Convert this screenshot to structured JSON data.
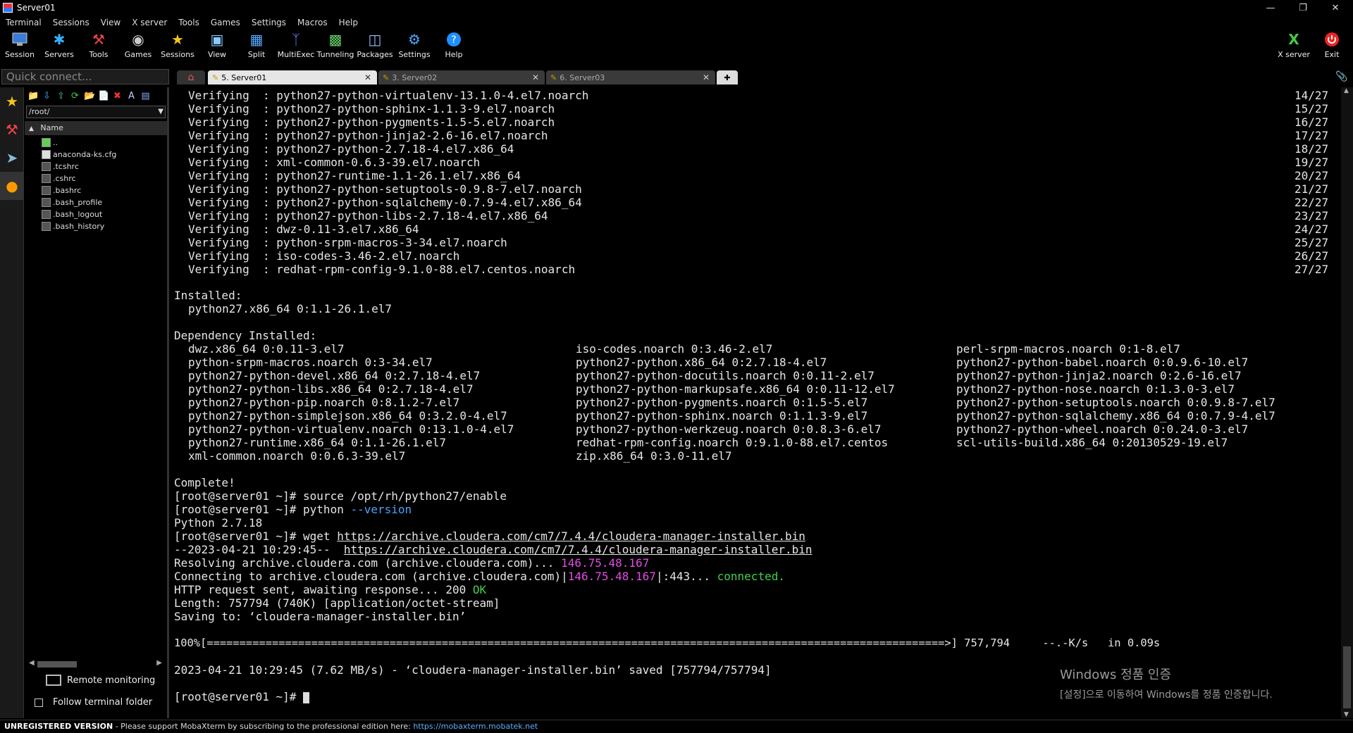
{
  "window": {
    "title": "Server01"
  },
  "menu": [
    "Terminal",
    "Sessions",
    "View",
    "X server",
    "Tools",
    "Games",
    "Settings",
    "Macros",
    "Help"
  ],
  "toolbar": {
    "buttons": [
      {
        "label": "Session",
        "icon": "session-icon"
      },
      {
        "label": "Servers",
        "icon": "servers-icon"
      },
      {
        "label": "Tools",
        "icon": "tools-icon"
      },
      {
        "label": "Games",
        "icon": "games-icon"
      },
      {
        "label": "Sessions",
        "icon": "star-icon"
      },
      {
        "label": "View",
        "icon": "view-icon"
      },
      {
        "label": "Split",
        "icon": "split-icon"
      },
      {
        "label": "MultiExec",
        "icon": "multiexec-icon"
      },
      {
        "label": "Tunneling",
        "icon": "tunneling-icon"
      },
      {
        "label": "Packages",
        "icon": "packages-icon"
      },
      {
        "label": "Settings",
        "icon": "settings-icon"
      },
      {
        "label": "Help",
        "icon": "help-icon"
      }
    ],
    "right_buttons": [
      {
        "label": "X server",
        "icon": "xserver-icon"
      },
      {
        "label": "Exit",
        "icon": "exit-icon"
      }
    ]
  },
  "quick_connect": {
    "placeholder": "Quick connect..."
  },
  "tabs": [
    {
      "label": "5. Server01",
      "active": true
    },
    {
      "label": "3. Server02",
      "active": false
    },
    {
      "label": "6. Server03",
      "active": false
    }
  ],
  "sidebar": {
    "path": "/root/",
    "column_header": "Name",
    "files": [
      "..",
      "anaconda-ks.cfg",
      ".tcshrc",
      ".cshrc",
      ".bashrc",
      ".bash_profile",
      ".bash_logout",
      ".bash_history"
    ],
    "remote_monitoring": "Remote monitoring",
    "follow_terminal": "Follow terminal folder"
  },
  "terminal": {
    "verifying": [
      {
        "pkg": "python27-python-virtualenv-13.1.0-4.el7.noarch",
        "count": "14/27"
      },
      {
        "pkg": "python27-python-sphinx-1.1.3-9.el7.noarch",
        "count": "15/27"
      },
      {
        "pkg": "python27-python-pygments-1.5-5.el7.noarch",
        "count": "16/27"
      },
      {
        "pkg": "python27-python-jinja2-2.6-16.el7.noarch",
        "count": "17/27"
      },
      {
        "pkg": "python27-python-2.7.18-4.el7.x86_64",
        "count": "18/27"
      },
      {
        "pkg": "xml-common-0.6.3-39.el7.noarch",
        "count": "19/27"
      },
      {
        "pkg": "python27-runtime-1.1-26.1.el7.x86_64",
        "count": "20/27"
      },
      {
        "pkg": "python27-python-setuptools-0.9.8-7.el7.noarch",
        "count": "21/27"
      },
      {
        "pkg": "python27-python-sqlalchemy-0.7.9-4.el7.x86_64",
        "count": "22/27"
      },
      {
        "pkg": "python27-python-libs-2.7.18-4.el7.x86_64",
        "count": "23/27"
      },
      {
        "pkg": "dwz-0.11-3.el7.x86_64",
        "count": "24/27"
      },
      {
        "pkg": "python-srpm-macros-3-34.el7.noarch",
        "count": "25/27"
      },
      {
        "pkg": "iso-codes-3.46-2.el7.noarch",
        "count": "26/27"
      },
      {
        "pkg": "redhat-rpm-config-9.1.0-88.el7.centos.noarch",
        "count": "27/27"
      }
    ],
    "verifying_label": "Verifying  :",
    "installed_header": "Installed:",
    "installed_pkg": "python27.x86_64 0:1.1-26.1.el7",
    "dep_header": "Dependency Installed:",
    "deps": [
      [
        "dwz.x86_64 0:0.11-3.el7",
        "iso-codes.noarch 0:3.46-2.el7",
        "perl-srpm-macros.noarch 0:1-8.el7"
      ],
      [
        "python-srpm-macros.noarch 0:3-34.el7",
        "python27-python.x86_64 0:2.7.18-4.el7",
        "python27-python-babel.noarch 0:0.9.6-10.el7"
      ],
      [
        "python27-python-devel.x86_64 0:2.7.18-4.el7",
        "python27-python-docutils.noarch 0:0.11-2.el7",
        "python27-python-jinja2.noarch 0:2.6-16.el7"
      ],
      [
        "python27-python-libs.x86_64 0:2.7.18-4.el7",
        "python27-python-markupsafe.x86_64 0:0.11-12.el7",
        "python27-python-nose.noarch 0:1.3.0-3.el7"
      ],
      [
        "python27-python-pip.noarch 0:8.1.2-7.el7",
        "python27-python-pygments.noarch 0:1.5-5.el7",
        "python27-python-setuptools.noarch 0:0.9.8-7.el7"
      ],
      [
        "python27-python-simplejson.x86_64 0:3.2.0-4.el7",
        "python27-python-sphinx.noarch 0:1.1.3-9.el7",
        "python27-python-sqlalchemy.x86_64 0:0.7.9-4.el7"
      ],
      [
        "python27-python-virtualenv.noarch 0:13.1.0-4.el7",
        "python27-python-werkzeug.noarch 0:0.8.3-6.el7",
        "python27-python-wheel.noarch 0:0.24.0-3.el7"
      ],
      [
        "python27-runtime.x86_64 0:1.1-26.1.el7",
        "redhat-rpm-config.noarch 0:9.1.0-88.el7.centos",
        "scl-utils-build.x86_64 0:20130529-19.el7"
      ],
      [
        "xml-common.noarch 0:0.6.3-39.el7",
        "zip.x86_64 0:3.0-11.el7",
        ""
      ]
    ],
    "complete": "Complete!",
    "prompt": "[root@server01 ~]# ",
    "cmd_source": "source /opt/rh/python27/enable",
    "cmd_python": "python ",
    "cmd_python_flag": "--version",
    "python_version": "Python 2.7.18",
    "cmd_wget": "wget ",
    "url": "https://archive.cloudera.com/cm7/7.4.4/cloudera-manager-installer.bin",
    "wget_time": "--2023-04-21 10:29:45--  ",
    "resolving": "Resolving archive.cloudera.com (archive.cloudera.com)... ",
    "ip": "146.75.48.167",
    "connecting": "Connecting to archive.cloudera.com (archive.cloudera.com)|",
    "connecting_tail": "|:443... ",
    "connected": "connected.",
    "http_sent": "HTTP request sent, awaiting response... 200 ",
    "ok": "OK",
    "length": "Length: 757794 (740K) [application/octet-stream]",
    "saving": "Saving to: ‘cloudera-manager-installer.bin’",
    "progress": "100%[=================================================================================================================>] 757,794     --.-K/s   in 0.09s",
    "saved": "2023-04-21 10:29:45 (7.62 MB/s) - ‘cloudera-manager-installer.bin’ saved [757794/757794]"
  },
  "watermark": {
    "title": "Windows 정품 인증",
    "subtitle": "[설정]으로 이동하여 Windows를 정품 인증합니다."
  },
  "status": {
    "unregistered": "UNREGISTERED VERSION",
    "message": " -  Please support MobaXterm by subscribing to the professional edition here: ",
    "url": "https://mobaxterm.mobatek.net"
  }
}
